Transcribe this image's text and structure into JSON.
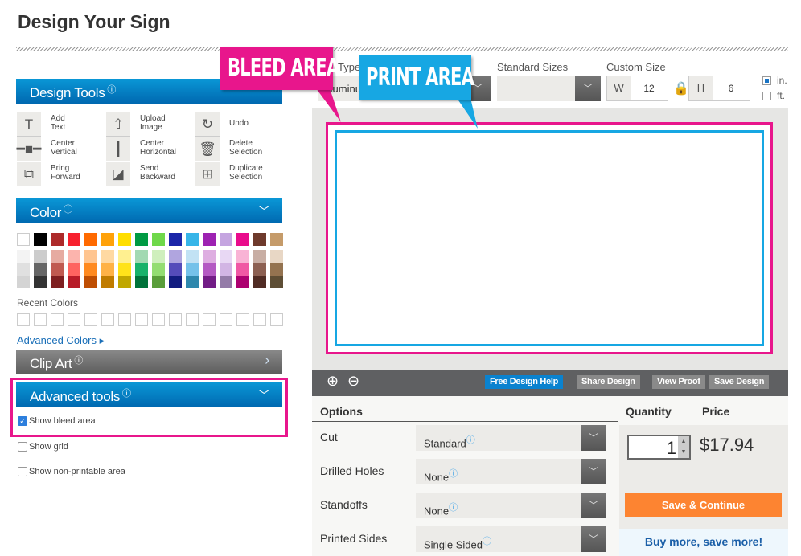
{
  "page_title": "Design Your Sign",
  "design_tools": {
    "title": "Design Tools",
    "tools": [
      {
        "icon": "text-icon",
        "glyph": "T",
        "label1": "Add",
        "label2": "Text"
      },
      {
        "icon": "center-vertical-icon",
        "glyph": "━■━",
        "label1": "Center",
        "label2": "Vertical"
      },
      {
        "icon": "bring-forward-icon",
        "glyph": "⧉",
        "label1": "Bring",
        "label2": "Forward"
      },
      {
        "icon": "upload-image-icon",
        "glyph": "⇧",
        "label1": "Upload",
        "label2": "Image"
      },
      {
        "icon": "center-horizontal-icon",
        "glyph": "┃",
        "label1": "Center",
        "label2": "Horizontal"
      },
      {
        "icon": "send-backward-icon",
        "glyph": "◪",
        "label1": "Send",
        "label2": "Backward"
      },
      {
        "icon": "undo-icon",
        "glyph": "↻",
        "label1": "Undo",
        "label2": ""
      },
      {
        "icon": "delete-icon",
        "glyph": "🗑",
        "label1": "Delete",
        "label2": "Selection"
      },
      {
        "icon": "duplicate-icon",
        "glyph": "⊞",
        "label1": "Duplicate",
        "label2": "Selection"
      }
    ]
  },
  "color": {
    "title": "Color",
    "row1": [
      "#ffffff",
      "#000000",
      "#ad2a2a",
      "#f7212f",
      "#ff6a00",
      "#ffa20a",
      "#ffde00",
      "#009a43",
      "#6fd84a",
      "#1b26a8",
      "#37b5e8",
      "#9d22b2",
      "#c5a5e0",
      "#e90c8c",
      "#6e3a2c",
      "#c59b6a"
    ],
    "row2": [
      "#f3f3f3",
      "#cccccc",
      "#e6aba1",
      "#fcb4ad",
      "#ffc590",
      "#ffd9a2",
      "#fff090",
      "#a2d9b2",
      "#cfefbd",
      "#b0a5df",
      "#c2e2f4",
      "#deaee1",
      "#e8d8f4",
      "#f9b3d5",
      "#c8aea4",
      "#e8d7c5"
    ],
    "row3": [
      "#e0e0e0",
      "#666666",
      "#c05a50",
      "#fe6460",
      "#ff8a20",
      "#ffb246",
      "#ffe31a",
      "#18b26a",
      "#94dd72",
      "#554cba",
      "#75c2ea",
      "#b45ac3",
      "#d2b5e4",
      "#f058a4",
      "#8c6052",
      "#947350"
    ],
    "row4": [
      "#d4d4d4",
      "#333333",
      "#7e1f20",
      "#b81c28",
      "#be4e03",
      "#c07c00",
      "#c0a700",
      "#00733a",
      "#5a9e3a",
      "#121c80",
      "#2e88ad",
      "#721c86",
      "#947ba8",
      "#ad0070",
      "#502c24",
      "#5e4e35"
    ],
    "recent_label": "Recent Colors",
    "advanced_link": "Advanced Colors ▸"
  },
  "clip_art": {
    "title": "Clip Art"
  },
  "advanced_tools": {
    "title": "Advanced tools",
    "show_bleed": "Show bleed area",
    "show_grid": "Show grid",
    "show_nonprint": "Show non-printable area",
    "bleed_checked": true,
    "grid_checked": false,
    "nonprint_checked": false
  },
  "info_glyph": "ⓘ",
  "chev_down": "﹀",
  "chev_right": "›",
  "top": {
    "type_label": "Type",
    "type_value": "Aluminum",
    "standard_label": "Standard Sizes",
    "standard_value": "",
    "custom_label": "Custom Size",
    "w_label": "W",
    "w_value": "12",
    "h_label": "H",
    "h_value": "6",
    "unit_in": "in.",
    "unit_ft": "ft.",
    "unit_selected": "in."
  },
  "callouts": {
    "bleed": "BLEED AREA",
    "print": "PRINT AREA",
    "bleed_color": "#e8168c",
    "print_color": "#17a7e3"
  },
  "toolbar": {
    "free_help": "Free Design Help",
    "share": "Share Design",
    "proof": "View Proof",
    "save": "Save Design"
  },
  "options": {
    "header": "Options",
    "qty_header": "Quantity",
    "price_header": "Price",
    "rows": [
      {
        "label": "Cut",
        "value": "Standard"
      },
      {
        "label": "Drilled Holes",
        "value": "None"
      },
      {
        "label": "Standoffs",
        "value": "None"
      },
      {
        "label": "Printed Sides",
        "value": "Single Sided"
      }
    ],
    "quantity": "1",
    "price": "$17.94",
    "save_continue": "Save & Continue",
    "buy_more": "Buy more, save more!"
  }
}
